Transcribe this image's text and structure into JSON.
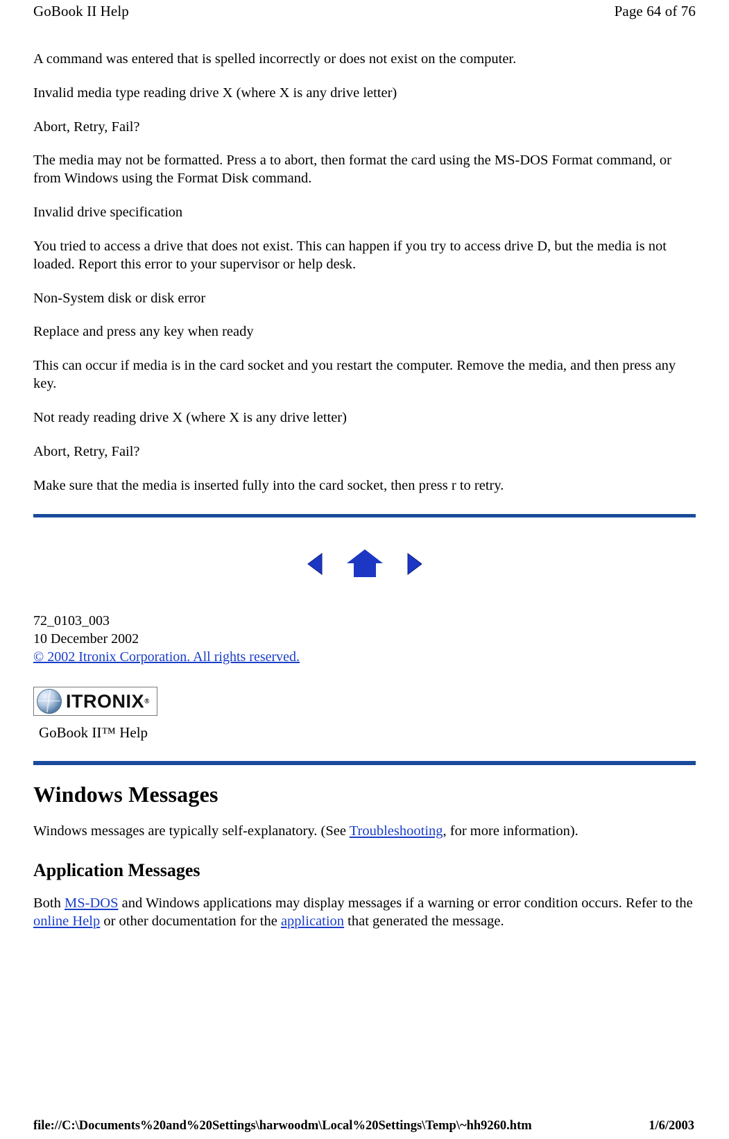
{
  "header": {
    "title": "GoBook II Help",
    "page_indicator": "Page 64 of 76"
  },
  "content": {
    "paragraphs": [
      "A command was entered that is spelled incorrectly or does not exist on the computer.",
      "Invalid media type reading drive X (where X is any drive letter)",
      "Abort, Retry, Fail?",
      "The media may not be formatted. Press a to abort, then format the card using the MS-DOS Format command, or from Windows using the Format Disk command.",
      "Invalid drive specification",
      "You tried to access a drive that does not exist. This can happen if you try to access drive D, but the media is not loaded. Report this error to your supervisor or help desk.",
      "Non-System disk or disk error",
      "Replace and press any key when ready",
      "This can occur if media is in the card socket and you restart the computer. Remove the media, and then press any key.",
      "Not ready reading drive X (where X is any drive letter)",
      "Abort, Retry, Fail?",
      "Make sure that the media is inserted fully into the card socket, then press r to retry."
    ]
  },
  "nav": {
    "previous_label": "Previous",
    "home_label": "Home",
    "next_label": "Next"
  },
  "docinfo": {
    "doc_number": "72_0103_003",
    "date": "10 December 2002",
    "copyright": "© 2002 Itronix Corporation.  All rights reserved."
  },
  "branding": {
    "logo_word": "ITRONIX",
    "logo_registered": "®",
    "product_title": "GoBook II™ Help"
  },
  "sections": [
    {
      "heading": "Windows Messages",
      "body_before": "Windows messages are typically self-explanatory. (See ",
      "link": "Troubleshooting",
      "body_after": ", for more information)."
    },
    {
      "heading": "Application Messages",
      "line1_a": "Both ",
      "line1_link": "MS-DOS",
      "line1_b": " and Windows applications may display messages if a warning or error condition occurs. Refer to the ",
      "line2_link1": "online Help",
      "line2_b": " or other documentation for the ",
      "line2_link2": "application",
      "line2_c": " that generated the message."
    }
  ],
  "footer": {
    "path": "file://C:\\Documents%20and%20Settings\\harwoodm\\Local%20Settings\\Temp\\~hh9260.htm",
    "date": "1/6/2003"
  },
  "colors": {
    "rule": "#1a4b9b",
    "link": "#1a3ec8",
    "nav_blue": "#1b37c4"
  }
}
